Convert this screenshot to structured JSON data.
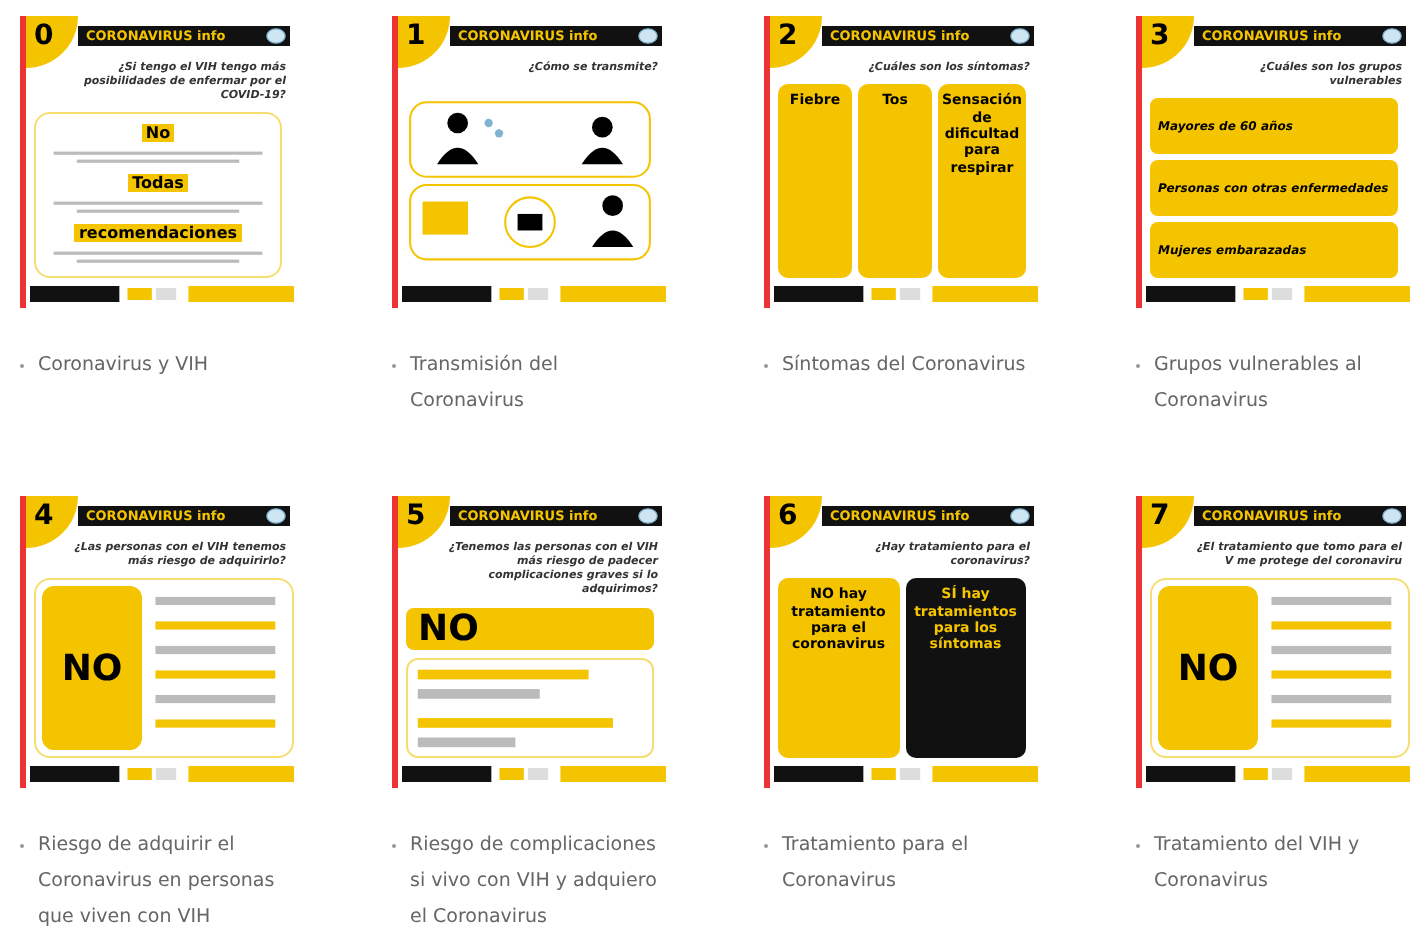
{
  "items": [
    {
      "slide": {
        "number": "0",
        "header": "CORONAVIRUS info",
        "question": "¿Si tengo el VIH tengo más posibilidades de enfermar por el COVID-19?",
        "kind": "card",
        "tiles": [
          {
            "text": "No",
            "dark": false
          },
          {
            "text": "Todas",
            "dark": false
          },
          {
            "text": "recomendaciones",
            "dark": false
          }
        ]
      },
      "caption": "Coronavirus y VIH"
    },
    {
      "slide": {
        "number": "1",
        "header": "CORONAVIRUS info",
        "question": "¿Cómo se transmite?",
        "kind": "diagram"
      },
      "caption": "Transmisión del Coronavirus"
    },
    {
      "slide": {
        "number": "2",
        "header": "CORONAVIRUS info",
        "question": "¿Cuáles son los síntomas?",
        "kind": "grid",
        "tiles": [
          {
            "text": "Fiebre",
            "dark": false
          },
          {
            "text": "Tos",
            "dark": false
          },
          {
            "text": "Sensación de dificultad para respirar",
            "dark": false
          }
        ]
      },
      "caption": "Síntomas del Coronavirus"
    },
    {
      "slide": {
        "number": "3",
        "header": "CORONAVIRUS info",
        "question": "¿Cuáles son los grupos vulnerables",
        "kind": "rows",
        "tiles": [
          {
            "text": "Mayores de 60 años",
            "dark": false
          },
          {
            "text": "Personas con otras enfermedades",
            "dark": false
          },
          {
            "text": "Mujeres embarazadas",
            "dark": false
          }
        ]
      },
      "caption": "Grupos vulnerables al Coronavirus"
    },
    {
      "slide": {
        "number": "4",
        "header": "CORONAVIRUS info",
        "question": "¿Las personas con el VIH tenemos más riesgo de adquirirlo?",
        "kind": "split",
        "tiles": [
          {
            "text": "NO",
            "dark": false
          }
        ]
      },
      "caption": "Riesgo de adquirir el Coronavirus en personas que viven con VIH"
    },
    {
      "slide": {
        "number": "5",
        "header": "CORONAVIRUS info",
        "question": "¿Tenemos las personas con el VIH más riesgo de padecer complicaciones graves si lo adquirimos?",
        "kind": "banner",
        "tiles": [
          {
            "text": "NO",
            "dark": false
          }
        ]
      },
      "caption": "Riesgo de complicaciones si vivo con VIH y adquiero el Coronavirus"
    },
    {
      "slide": {
        "number": "6",
        "header": "CORONAVIRUS info",
        "question": "¿Hay tratamiento para el coronavirus?",
        "kind": "grid",
        "tiles": [
          {
            "text": "NO hay tratamiento para el coronavirus",
            "dark": false
          },
          {
            "text": "SÍ hay tratamientos para los síntomas",
            "dark": true
          }
        ]
      },
      "caption": "Tratamiento para el Coronavirus"
    },
    {
      "slide": {
        "number": "7",
        "header": "CORONAVIRUS info",
        "question": "¿El tratamiento que tomo para el V me protege del coronaviru",
        "kind": "split",
        "tiles": [
          {
            "text": "NO",
            "dark": false
          }
        ]
      },
      "caption": "Tratamiento del VIH y Coronavirus"
    }
  ]
}
